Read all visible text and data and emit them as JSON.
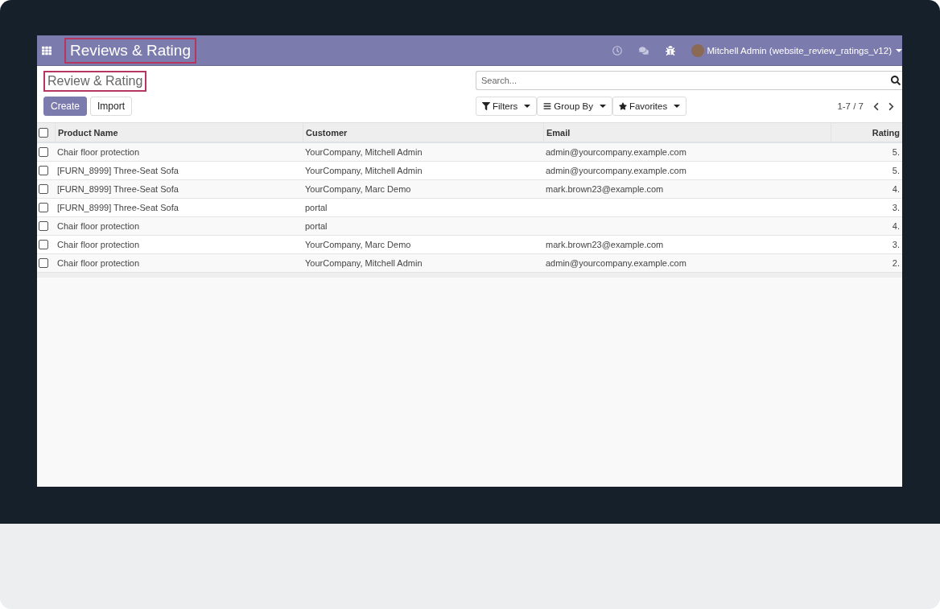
{
  "navbar": {
    "app_title": "Reviews & Rating",
    "user": "Mitchell Admin (website_review_ratings_v12)"
  },
  "control_panel": {
    "breadcrumb": "Review & Rating",
    "buttons": [
      {
        "label": "Create",
        "kind": "primary"
      },
      {
        "label": "Import",
        "kind": "secondary"
      }
    ],
    "search": {
      "placeholder": "Search..."
    },
    "search_options": [
      {
        "label": "Filters",
        "kind": "filter"
      },
      {
        "label": "Group By",
        "kind": "group"
      },
      {
        "label": "Favorites",
        "kind": "favorite"
      }
    ],
    "pager": "1-7 / 7"
  },
  "table": {
    "all_checked": false,
    "columns": [
      {
        "label": "Product Name"
      },
      {
        "label": "Customer"
      },
      {
        "label": "Email"
      },
      {
        "label": "Rating"
      }
    ],
    "rows": [
      {
        "checked": false,
        "cells": [
          "Chair floor protection",
          "YourCompany, Mitchell Admin",
          "admin@yourcompany.example.com",
          "5."
        ]
      },
      {
        "checked": false,
        "cells": [
          "[FURN_8999] Three-Seat Sofa",
          "YourCompany, Mitchell Admin",
          "admin@yourcompany.example.com",
          "5."
        ]
      },
      {
        "checked": false,
        "cells": [
          "[FURN_8999] Three-Seat Sofa",
          "YourCompany, Marc Demo",
          "mark.brown23@example.com",
          "4."
        ]
      },
      {
        "checked": false,
        "cells": [
          "[FURN_8999] Three-Seat Sofa",
          "portal",
          "",
          "3."
        ]
      },
      {
        "checked": false,
        "cells": [
          "Chair floor protection",
          "portal",
          "",
          "4."
        ]
      },
      {
        "checked": false,
        "cells": [
          "Chair floor protection",
          "YourCompany, Marc Demo",
          "mark.brown23@example.com",
          "3."
        ]
      },
      {
        "checked": false,
        "cells": [
          "Chair floor protection",
          "YourCompany, Mitchell Admin",
          "admin@yourcompany.example.com",
          "2."
        ]
      }
    ]
  }
}
